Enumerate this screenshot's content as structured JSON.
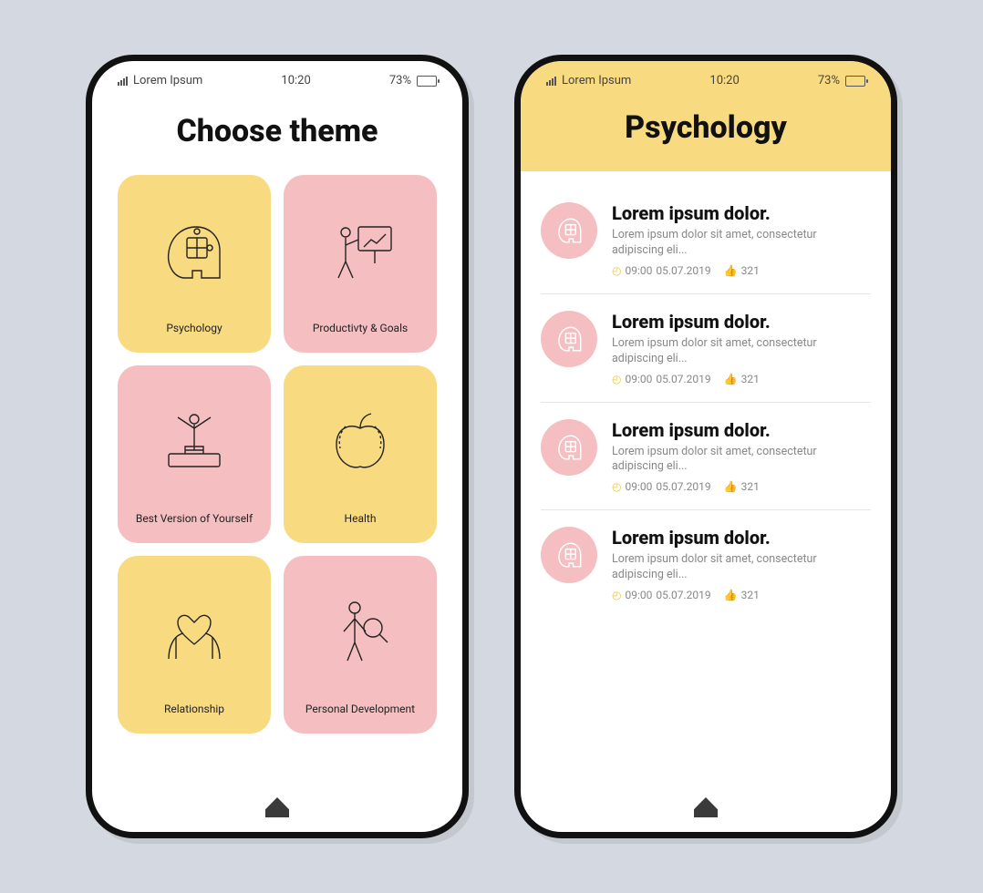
{
  "status": {
    "carrier": "Lorem Ipsum",
    "time": "10:20",
    "battery_pct": "73%"
  },
  "screen1": {
    "title": "Choose theme",
    "tiles": [
      {
        "label": "Psychology",
        "color": "yellow",
        "icon": "head-puzzle"
      },
      {
        "label": "Productivty & Goals",
        "color": "pink",
        "icon": "presenter"
      },
      {
        "label": "Best Version of Yourself",
        "color": "pink",
        "icon": "winner"
      },
      {
        "label": "Health",
        "color": "yellow",
        "icon": "apple-tape"
      },
      {
        "label": "Relationship",
        "color": "yellow",
        "icon": "hands-heart"
      },
      {
        "label": "Personal Development",
        "color": "pink",
        "icon": "person-magnify"
      }
    ]
  },
  "screen2": {
    "title": "Psychology",
    "items": [
      {
        "title": "Lorem ipsum dolor.",
        "desc": "Lorem ipsum dolor sit amet, consectetur adipiscing eli...",
        "time": "09:00",
        "date": "05.07.2019",
        "likes": "321"
      },
      {
        "title": "Lorem ipsum dolor.",
        "desc": "Lorem ipsum dolor sit amet, consectetur adipiscing eli...",
        "time": "09:00",
        "date": "05.07.2019",
        "likes": "321"
      },
      {
        "title": "Lorem ipsum dolor.",
        "desc": "Lorem ipsum dolor sit amet, consectetur adipiscing eli...",
        "time": "09:00",
        "date": "05.07.2019",
        "likes": "321"
      },
      {
        "title": "Lorem ipsum dolor.",
        "desc": "Lorem ipsum dolor sit amet, consectetur adipiscing eli...",
        "time": "09:00",
        "date": "05.07.2019",
        "likes": "321"
      }
    ]
  },
  "colors": {
    "yellow": "#f8da81",
    "pink": "#f5bfc2",
    "accent": "#e9c647"
  }
}
